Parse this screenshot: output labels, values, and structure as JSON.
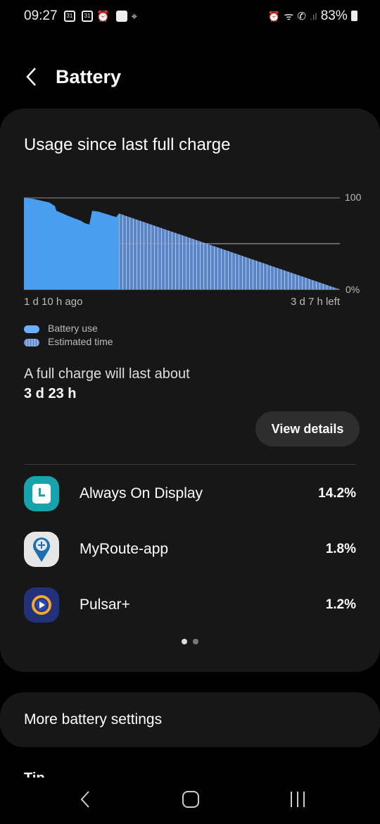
{
  "status_bar": {
    "time": "09:27",
    "cal1": "31",
    "cal2": "31",
    "battery": "83%",
    "icons": [
      "calendar-icon",
      "calendar-icon",
      "alarm-icon",
      "image-icon",
      "location-icon",
      "alarm-icon",
      "wifi-icon",
      "wifi-calling-icon",
      "signal-icon",
      "battery-icon"
    ]
  },
  "header": {
    "title": "Battery"
  },
  "usage": {
    "title": "Usage since last full charge",
    "y_top": "100",
    "y_bottom": "0%",
    "x_left": "1 d 10 h ago",
    "x_right": "3 d 7 h left",
    "legend": [
      "Battery use",
      "Estimated time"
    ],
    "full_charge_label": "A full charge will last about",
    "full_charge_value": "3 d 23 h",
    "view_details": "View details"
  },
  "chart_data": {
    "type": "area",
    "xlabel": "",
    "ylabel": "",
    "xlim": [
      -34,
      79
    ],
    "ylim": [
      0,
      100
    ],
    "gridlines_y": [
      0,
      50,
      100
    ],
    "series": [
      {
        "name": "Battery use",
        "color": "#4a9ef0",
        "x": [
          -34,
          -30.8,
          -24.9,
          -22.9,
          -22.4,
          -17.9,
          -13.6,
          -12.3,
          -10.6,
          -9.6,
          -7.3,
          -1,
          0
        ],
        "y": [
          100,
          99,
          95,
          91,
          86,
          80,
          75,
          72.5,
          71,
          86,
          85,
          79,
          83
        ]
      },
      {
        "name": "Estimated time",
        "color": "#5b86c6",
        "x": [
          0,
          79
        ],
        "y": [
          83,
          0
        ]
      }
    ]
  },
  "apps": [
    {
      "name": "Always On Display",
      "percent": "14.2%",
      "icon": "clock-icon"
    },
    {
      "name": "MyRoute-app",
      "percent": "1.8%",
      "icon": "map-pin-icon"
    },
    {
      "name": "Pulsar+",
      "percent": "1.2%",
      "icon": "play-icon"
    }
  ],
  "more_settings": "More battery settings",
  "tips": "Tip"
}
